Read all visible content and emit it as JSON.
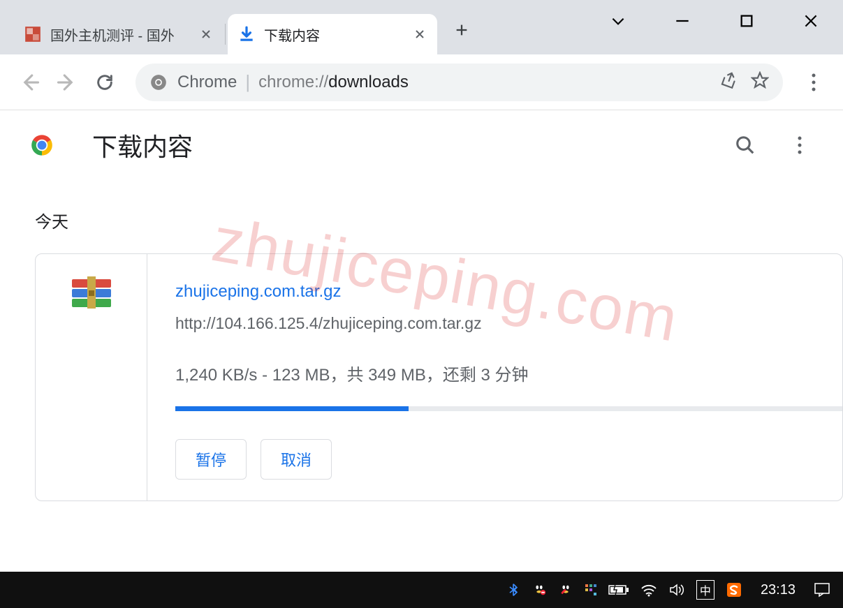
{
  "window": {
    "watermark": "zhujiceping.com"
  },
  "tabs": [
    {
      "label": "国外主机测评 - 国外",
      "active": false
    },
    {
      "label": "下载内容",
      "active": true
    }
  ],
  "address": {
    "chip": "Chrome",
    "protocol": "chrome://",
    "host": "downloads"
  },
  "page": {
    "title": "下载内容",
    "section_today": "今天"
  },
  "download": {
    "filename": "zhujiceping.com.tar.gz",
    "url": "http://104.166.125.4/zhujiceping.com.tar.gz",
    "status": "1,240 KB/s - 123 MB，共 349 MB，还剩 3 分钟",
    "progress_pct": 35,
    "pause_label": "暂停",
    "cancel_label": "取消"
  },
  "taskbar": {
    "ime": "中",
    "clock": "23:13"
  }
}
